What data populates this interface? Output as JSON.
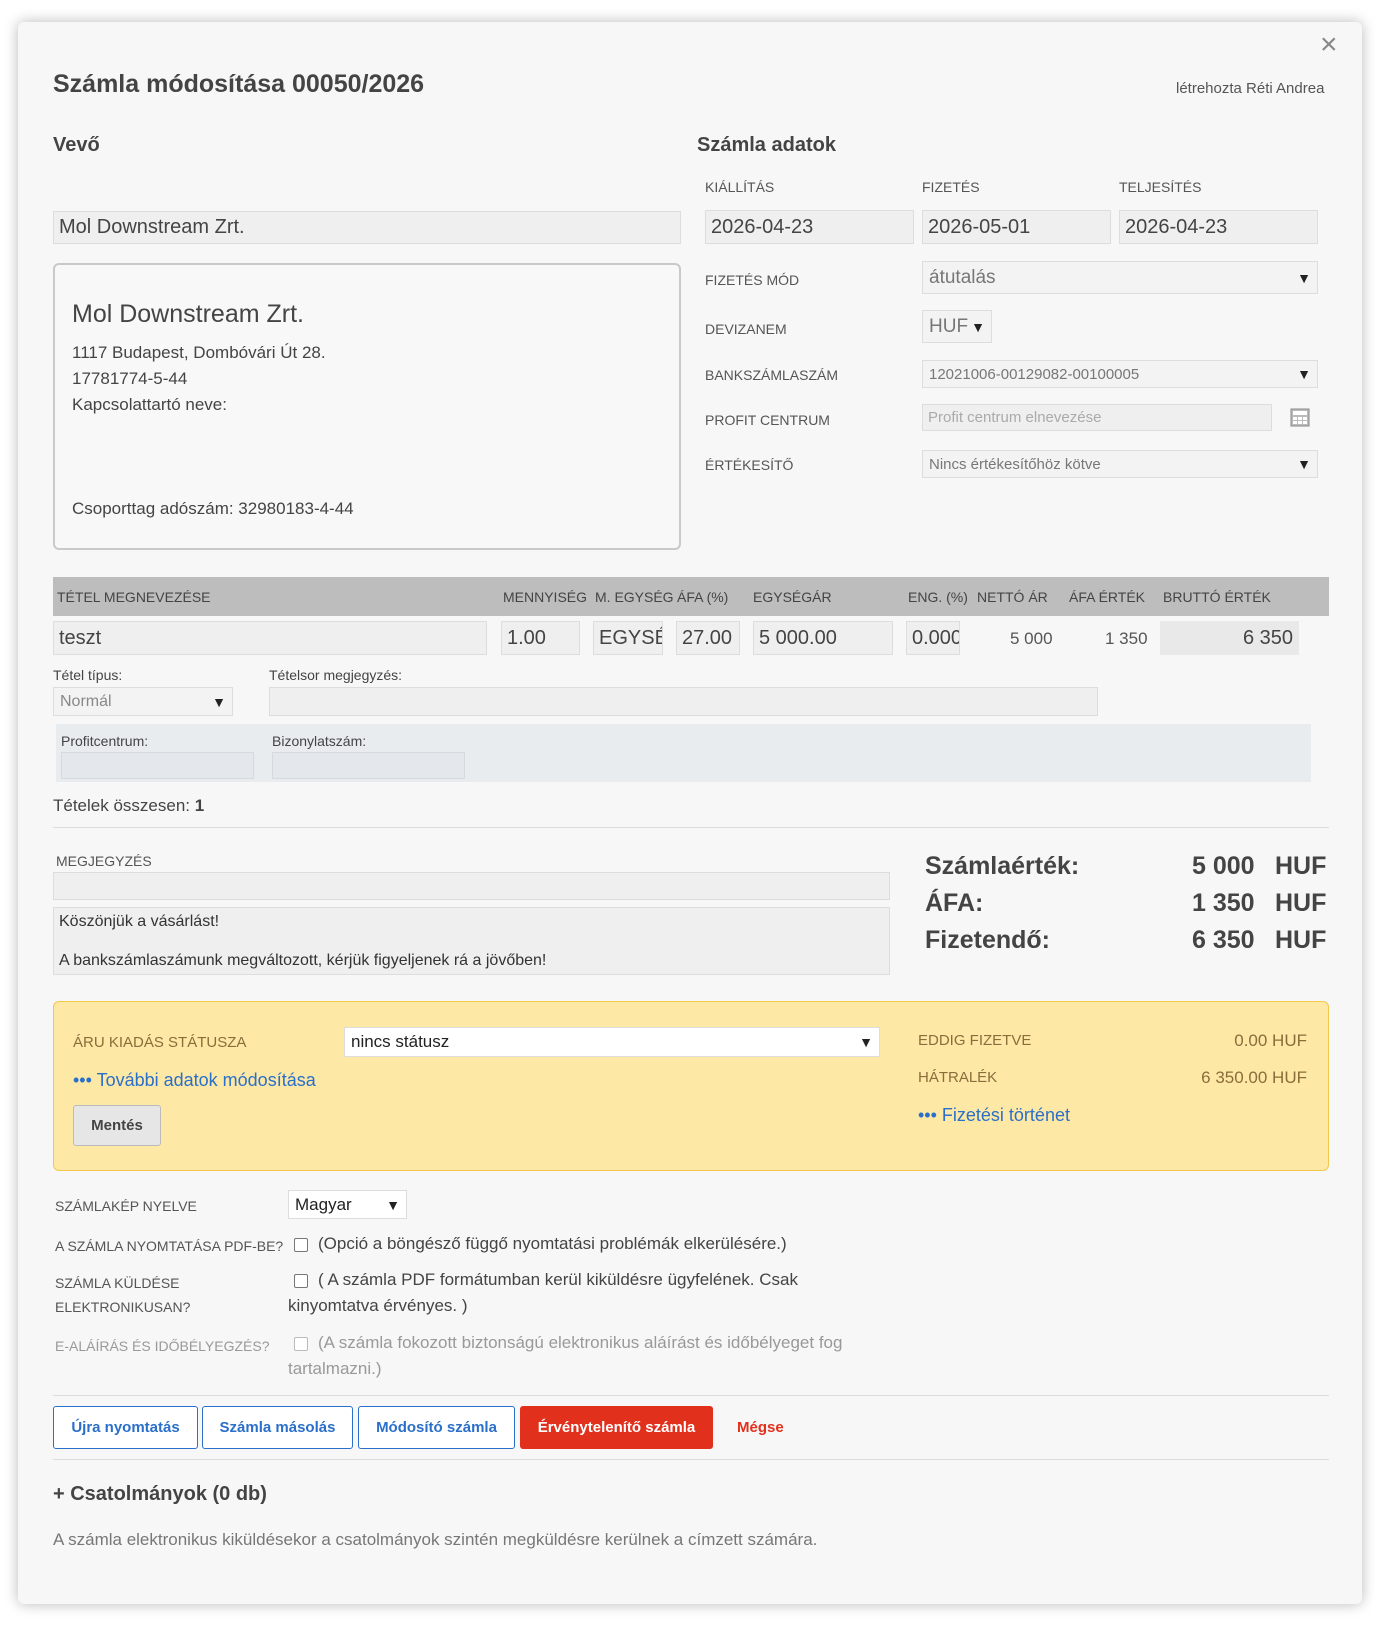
{
  "header": {
    "title": "Számla módosítása 00050/2026",
    "creator": "létrehozta Réti Andrea",
    "close_icon": "×"
  },
  "buyer": {
    "heading": "Vevő",
    "search_value": "Mol Downstream Zrt.",
    "name": "Mol Downstream Zrt.",
    "address": "1117 Budapest, Dombóvári Út 28.",
    "tax_number": "17781774-5-44",
    "contact": "Kapcsolattartó neve:",
    "group_tax": "Csoporttag adószám: 32980183-4-44"
  },
  "invoice_data": {
    "heading": "Számla adatok",
    "issue_label": "KIÁLLÍTÁS",
    "payment_label": "FIZETÉS",
    "fulfillment_label": "TELJESÍTÉS",
    "issue_date": "2026-04-23",
    "payment_date": "2026-05-01",
    "fulfillment_date": "2026-04-23",
    "payment_method_label": "FIZETÉS MÓD",
    "payment_method": "átutalás",
    "currency_label": "DEVIZANEM",
    "currency": "HUF",
    "bank_label": "BANKSZÁMLASZÁM",
    "bank_account": "12021006-00129082-00100005",
    "profit_center_label": "PROFIT CENTRUM",
    "profit_center_placeholder": "Profit centrum elnevezése",
    "seller_label": "ÉRTÉKESÍTŐ",
    "seller": "Nincs értékesítőhöz kötve"
  },
  "items_table": {
    "headers": [
      "TÉTEL MEGNEVEZÉSE",
      "MENNYISÉG",
      "M. EGYSÉG",
      "ÁFA (%)",
      "EGYSÉGÁR",
      "ENG. (%)",
      "NETTÓ ÁR",
      "ÁFA ÉRTÉK",
      "BRUTTÓ ÉRTÉK"
    ],
    "rows": [
      {
        "name": "teszt",
        "quantity": "1.00",
        "unit": "EGYSÉG",
        "vat": "27.00",
        "unit_price": "5 000.00",
        "discount": "0.000",
        "net": "5 000",
        "vat_value": "1 350",
        "gross": "6 350"
      }
    ],
    "item_type_label": "Tétel típus:",
    "item_type": "Normál",
    "item_note_label": "Tételsor megjegyzés:",
    "profit_center_label": "Profitcentrum:",
    "document_number_label": "Bizonylatszám:",
    "total_items_label": "Tételek összesen:",
    "total_items": "1"
  },
  "note": {
    "label": "MEGJEGYZÉS",
    "line1": "Köszönjük a vásárlást!",
    "line2": "A bankszámlaszámunk megváltozott, kérjük figyeljenek rá a jövőben!"
  },
  "totals": {
    "invoice_value_label": "Számlaérték:",
    "invoice_value": "5 000",
    "vat_label": "ÁFA:",
    "vat": "1 350",
    "payable_label": "Fizetendő:",
    "payable": "6 350",
    "currency": "HUF"
  },
  "status_panel": {
    "delivery_status_label": "ÁRU KIADÁS STÁTUSZA",
    "delivery_status": "nincs státusz",
    "more_data_link": "••• További adatok módosítása",
    "save_button": "Mentés",
    "paid_label": "EDDIG FIZETVE",
    "paid": "0.00 HUF",
    "arrears_label": "HÁTRALÉK",
    "arrears": "6 350.00 HUF",
    "payment_history_link": "••• Fizetési történet"
  },
  "options": {
    "language_label": "SZÁMLAKÉP NYELVE",
    "language": "Magyar",
    "pdf_label": "A SZÁMLA NYOMTATÁSA PDF-BE?",
    "pdf_text": "(Opció a böngésző függő nyomtatási problémák elkerülésére.)",
    "electronic_label_1": "SZÁMLA KÜLDÉSE",
    "electronic_label_2": "ELEKTRONIKUSAN?",
    "electronic_text_1": "( A számla PDF formátumban kerül kiküldésre ügyfelének. Csak",
    "electronic_text_2": "kinyomtatva érvényes. )",
    "esign_label": "E-ALÁÍRÁS ÉS IDŐBÉLYEGZÉS?",
    "esign_text_1": "(A számla fokozott biztonságú elektronikus aláírást és időbélyeget fog",
    "esign_text_2": "tartalmazni.)"
  },
  "actions": {
    "reprint": "Újra nyomtatás",
    "copy": "Számla másolás",
    "modify": "Módosító számla",
    "cancel_invoice": "Érvénytelenítő számla",
    "cancel": "Mégse"
  },
  "attachments": {
    "heading": "+ Csatolmányok (0 db)",
    "info": "A számla elektronikus kiküldésekor a csatolmányok szintén megküldésre kerülnek a címzett számára."
  },
  "colors": {
    "accent": "#2a6fc9",
    "danger": "#e1301c",
    "warning_bg": "#fde8a6"
  }
}
